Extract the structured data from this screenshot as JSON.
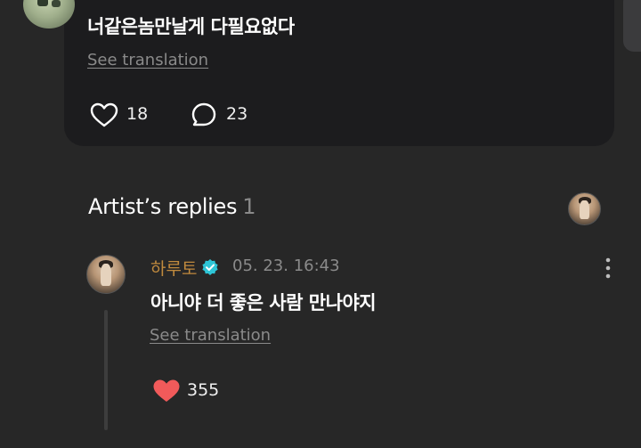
{
  "top_comment": {
    "text": "너같은놈만날게 다필요없다",
    "see_translation": "See translation",
    "likes": "18",
    "replies": "23"
  },
  "artist_replies": {
    "title": "Artist’s replies",
    "count": "1"
  },
  "reply": {
    "author": "하루토",
    "timestamp": "05. 23. 16:43",
    "text": "아니야 더 좋은 사람 만나야지",
    "see_translation": "See translation",
    "likes": "355"
  },
  "colors": {
    "background": "#272727",
    "card": "#1c1c1e",
    "author_name": "#c08a3e",
    "verified_badge": "#2ec5d6",
    "heart_filled": "#f15a5a",
    "muted_text": "#8a8a8a"
  },
  "icons": [
    "heart-outline-icon",
    "comment-bubble-icon",
    "verified-badge-icon",
    "more-vertical-icon",
    "heart-filled-icon"
  ]
}
